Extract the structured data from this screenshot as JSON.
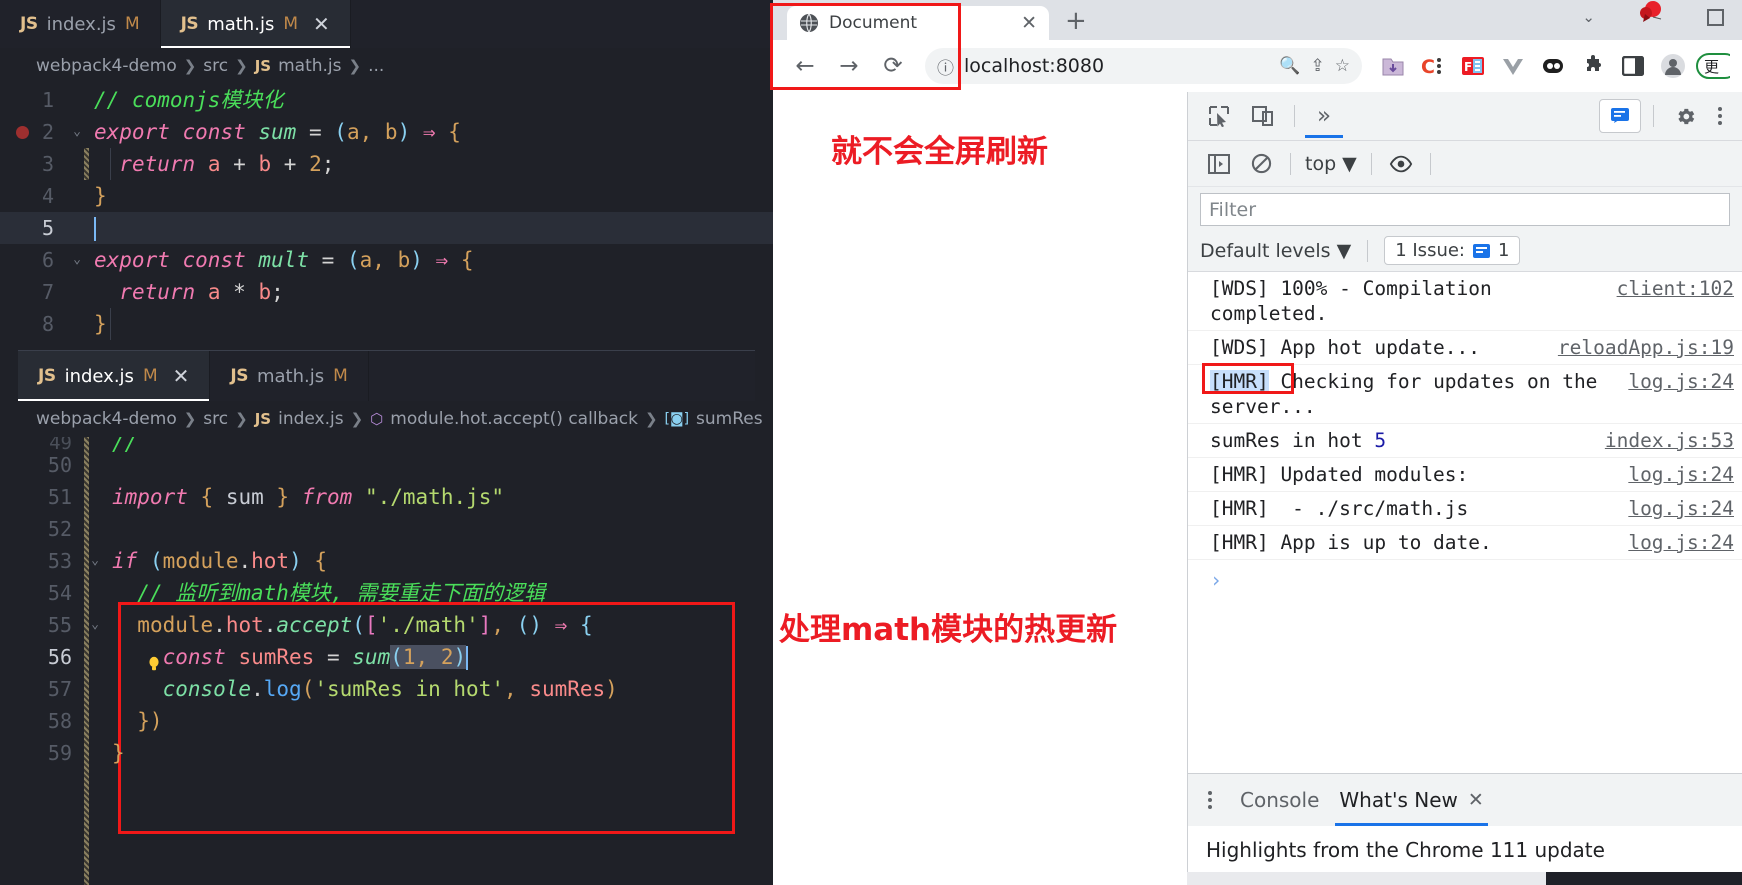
{
  "vscode": {
    "upper": {
      "tabs": [
        {
          "icon": "js-file-icon",
          "name": "index.js",
          "modified": "M",
          "close": ""
        },
        {
          "icon": "js-file-icon",
          "name": "math.js",
          "modified": "M",
          "close": "✕"
        }
      ],
      "active_tab_index": 1,
      "breadcrumb": [
        "webpack4-demo",
        "src",
        "math.js",
        "..."
      ],
      "breadcrumb_file_icon": "JS",
      "lines": [
        {
          "n": "1",
          "text": "// comonjs模块化"
        },
        {
          "n": "2",
          "text": "export const sum = (a, b) ⇒ {"
        },
        {
          "n": "3",
          "text": "  return a + b + 2;"
        },
        {
          "n": "4",
          "text": "}"
        },
        {
          "n": "5",
          "text": ""
        },
        {
          "n": "6",
          "text": "export const mult = (a, b) ⇒ {"
        },
        {
          "n": "7",
          "text": "  return a * b;"
        },
        {
          "n": "8",
          "text": "}"
        }
      ],
      "current_line": "5",
      "breakpoint_line": "2"
    },
    "lower": {
      "tabs": [
        {
          "icon": "js-file-icon",
          "name": "index.js",
          "modified": "M",
          "close": "✕"
        },
        {
          "icon": "js-file-icon",
          "name": "math.js",
          "modified": "M",
          "close": ""
        }
      ],
      "active_tab_index": 0,
      "breadcrumb": [
        "webpack4-demo",
        "src",
        "index.js",
        "module.hot.accept() callback",
        "sumRes"
      ],
      "lines": [
        {
          "n": "49",
          "text": "//"
        },
        {
          "n": "50",
          "text": ""
        },
        {
          "n": "51",
          "text": "import { sum } from \"./math.js\""
        },
        {
          "n": "52",
          "text": ""
        },
        {
          "n": "53",
          "text": "if (module.hot) {"
        },
        {
          "n": "54",
          "text": "  // 监听到math模块, 需要重走下面的逻辑"
        },
        {
          "n": "55",
          "text": "  module.hot.accept(['./math'], () ⇒ {"
        },
        {
          "n": "56",
          "text": "    const sumRes = sum(1, 2)"
        },
        {
          "n": "57",
          "text": "    console.log('sumRes in hot', sumRes)"
        },
        {
          "n": "58",
          "text": "  })"
        },
        {
          "n": "59",
          "text": "}"
        }
      ],
      "current_line": "56",
      "selected_text": "1, 2)"
    }
  },
  "browser": {
    "tab": {
      "favicon": "globe-icon",
      "title": "Document",
      "close": "✕"
    },
    "newtab_label": "+",
    "nav": {
      "back": "←",
      "forward": "→",
      "reload": "⟳",
      "site_info_icon": "info-circle-icon",
      "url": "localhost:8080",
      "zoom_icon": "zoom-in-icon",
      "share_icon": "share-icon",
      "bookmark_icon": "star-icon"
    },
    "extensions": [
      {
        "name": "download-folder-icon",
        "glyph": ""
      },
      {
        "name": "c-extension-icon",
        "glyph": "C"
      },
      {
        "name": "fe-extension-icon",
        "glyph": "FE"
      },
      {
        "name": "vue-devtools-icon",
        "glyph": "V"
      },
      {
        "name": "dark-reader-icon",
        "glyph": ""
      },
      {
        "name": "extensions-puzzle-icon",
        "glyph": "🧩"
      },
      {
        "name": "side-panel-icon",
        "glyph": ""
      },
      {
        "name": "profile-avatar-icon",
        "glyph": ""
      }
    ],
    "window_controls": {
      "chevron": "⌄",
      "maximize": ""
    },
    "page_annotation": "就不会全屏刷新"
  },
  "annotations": {
    "code_annotation": "处理math模块的热更新"
  },
  "devtools": {
    "toolbar": {
      "inspect_icon": "inspect-element-icon",
      "device_icon": "device-toolbar-icon",
      "more_panels": "»",
      "chat_icon": "chat-bubble-icon",
      "settings_icon": "gear-icon",
      "menu_icon": "kebab-menu-icon"
    },
    "console_toolbar": {
      "sidebar_icon": "console-sidebar-icon",
      "clear_icon": "clear-console-icon",
      "context": "top",
      "eye_icon": "live-expression-icon"
    },
    "filter_placeholder": "Filter",
    "levels_label": "Default levels",
    "issues_label": "1 Issue:",
    "issues_count": "1",
    "messages": [
      {
        "text": "[WDS] 100% - Compilation completed.",
        "source": "client:102",
        "highlight": null,
        "boxed": false,
        "num": null
      },
      {
        "text": "[WDS] App hot update...",
        "source": "reloadApp.js:19",
        "highlight": null,
        "boxed": false,
        "num": null
      },
      {
        "text": "[HMR] Checking for updates on the server...",
        "source": "log.js:24",
        "highlight": "[HMR]",
        "boxed": true,
        "num": null
      },
      {
        "text": "sumRes in hot ",
        "source": "index.js:53",
        "highlight": null,
        "boxed": false,
        "num": "5"
      },
      {
        "text": "[HMR] Updated modules:",
        "source": "log.js:24",
        "highlight": null,
        "boxed": false,
        "num": null
      },
      {
        "text": "[HMR]  - ./src/math.js",
        "source": "log.js:24",
        "highlight": null,
        "boxed": false,
        "num": null
      },
      {
        "text": "[HMR] App is up to date.",
        "source": "log.js:24",
        "highlight": null,
        "boxed": false,
        "num": null
      }
    ],
    "prompt_glyph": "›",
    "drawer": {
      "tabs": [
        {
          "label": "Console",
          "active": false
        },
        {
          "label": "What's New",
          "active": true
        }
      ],
      "close_glyph": "✕",
      "content": "Highlights from the Chrome 111 update"
    }
  },
  "colors": {
    "accent_blue": "#1a73e8",
    "annotation_red": "#ec1c24",
    "editor_bg": "#1f2128",
    "comment_green": "#4ade5a"
  }
}
